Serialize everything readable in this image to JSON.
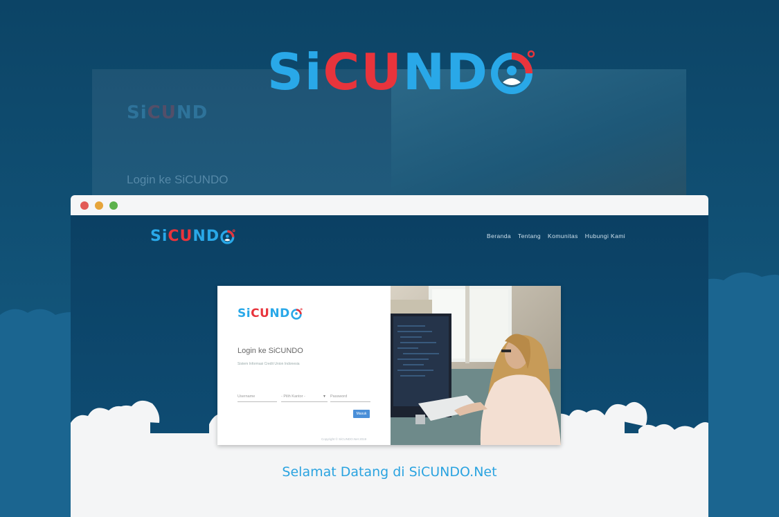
{
  "logo": {
    "text_blue": "Si",
    "text_red": "CU",
    "text_blue2": "ND"
  },
  "ghost": {
    "title": "Login ke SiCUNDO"
  },
  "window": {
    "dots": [
      "#e25b57",
      "#e6a53b",
      "#5cb24c"
    ]
  },
  "nav": {
    "items": [
      "Beranda",
      "Tentang",
      "Komunitas",
      "Hubungi Kami"
    ]
  },
  "login": {
    "title": "Login ke SiCUNDO",
    "subtitle": "Sistem Informasi Credit Union Indonesia",
    "username_placeholder": "Username",
    "office_select": "- Pilih Kantor -",
    "password_placeholder": "Password",
    "submit_label": "Masuk",
    "copyright": "Copyright © SiCUNDO.Net 2019"
  },
  "welcome": "Selamat Datang di SiCUNDO.Net",
  "colors": {
    "brand_blue": "#29a8e8",
    "brand_red": "#e8343c",
    "navy": "#0d4b73"
  }
}
